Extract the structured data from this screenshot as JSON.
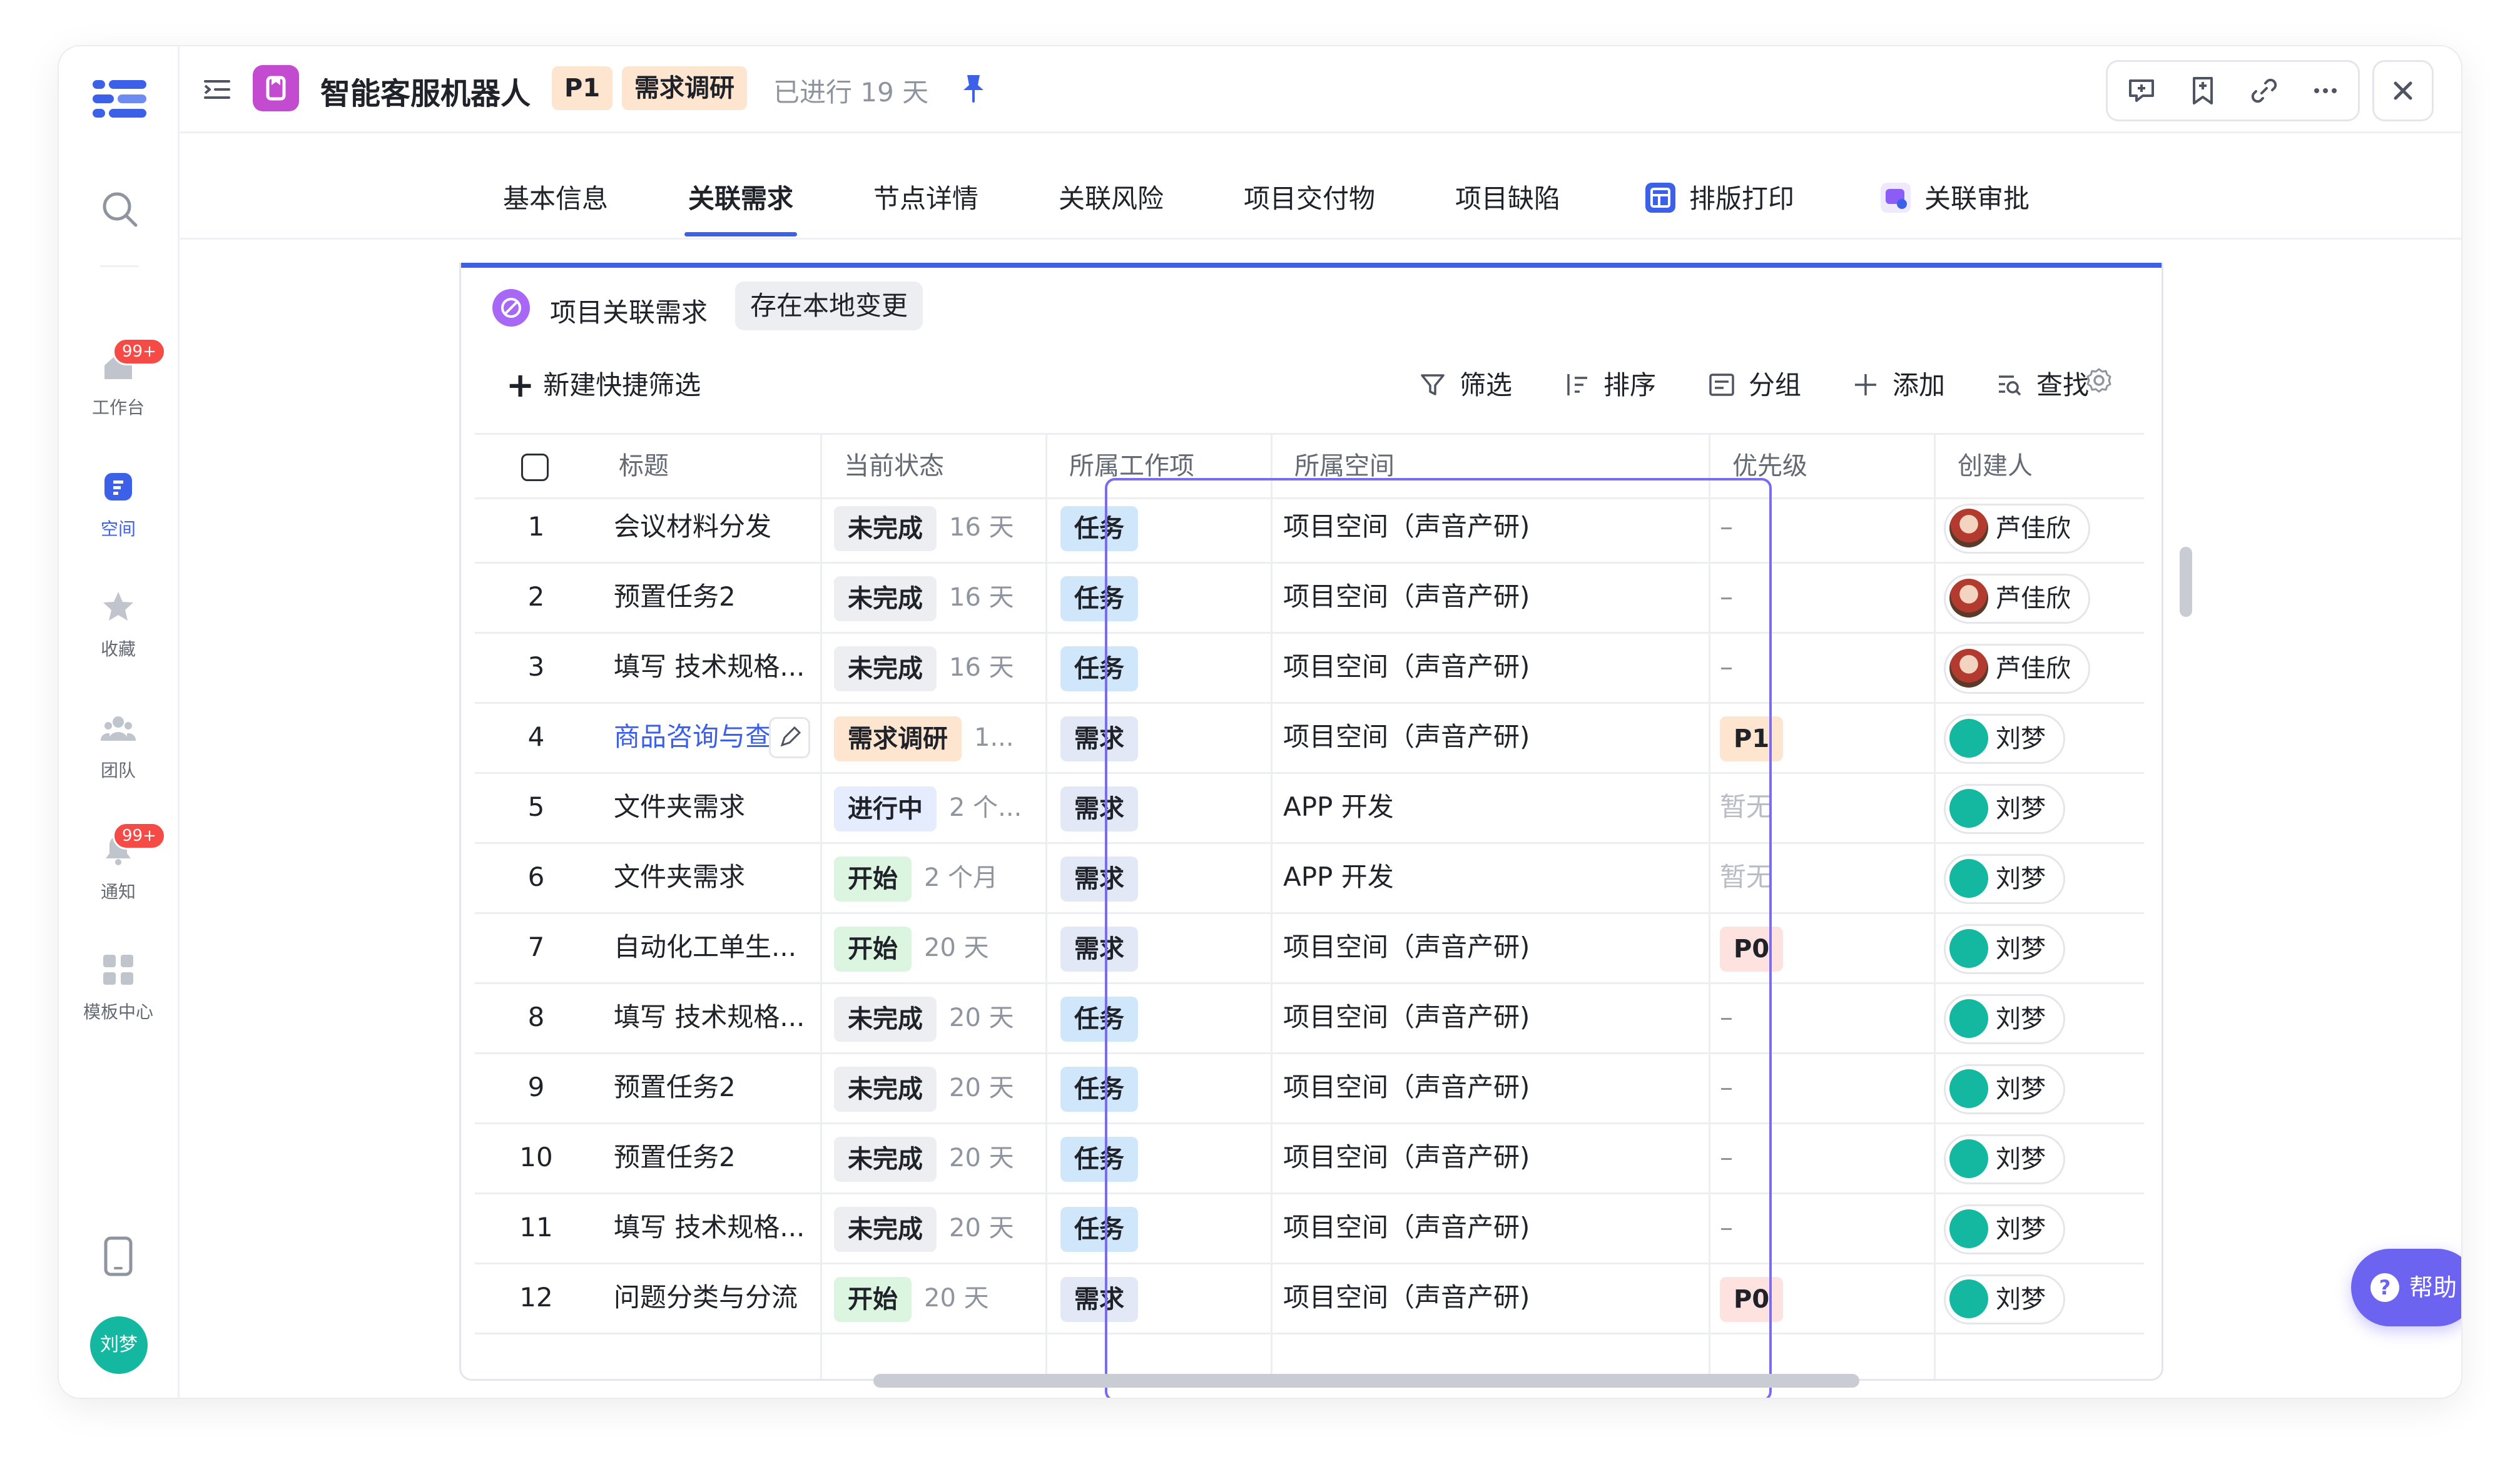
{
  "sidebar": {
    "items": [
      {
        "label": "工作台",
        "badge": "99+",
        "icon": "home-icon"
      },
      {
        "label": "空间",
        "badge": null,
        "icon": "space-icon",
        "active": true
      },
      {
        "label": "收藏",
        "badge": null,
        "icon": "star-icon"
      },
      {
        "label": "团队",
        "badge": null,
        "icon": "team-icon"
      },
      {
        "label": "通知",
        "badge": "99+",
        "icon": "bell-icon"
      },
      {
        "label": "模板中心",
        "badge": null,
        "icon": "template-icon"
      }
    ],
    "avatar_text": "刘梦"
  },
  "header": {
    "title": "智能客服机器人",
    "priority_tag": "P1",
    "stage_tag": "需求调研",
    "days_text": "已进行 19 天"
  },
  "tabs": [
    {
      "label": "基本信息"
    },
    {
      "label": "关联需求",
      "active": true
    },
    {
      "label": "节点详情"
    },
    {
      "label": "关联风险"
    },
    {
      "label": "项目交付物"
    },
    {
      "label": "项目缺陷"
    },
    {
      "label": "排版打印",
      "icon": "layout-print-icon"
    },
    {
      "label": "关联审批",
      "icon": "approval-icon"
    }
  ],
  "panel": {
    "title": "项目关联需求",
    "chip": "存在本地变更",
    "new_filter": "新建快捷筛选",
    "toolbar": {
      "filter": "筛选",
      "sort": "排序",
      "group": "分组",
      "add": "添加",
      "find": "查找"
    }
  },
  "table": {
    "headers": {
      "title": "标题",
      "status": "当前状态",
      "type": "所属工作项",
      "space": "所属空间",
      "priority": "优先级",
      "creator": "创建人"
    },
    "rows": [
      {
        "num": "1",
        "title": "会议材料分发",
        "status": "未完成",
        "status_color": "gray",
        "duration": "16 天",
        "type": "任务",
        "space": "项目空间（声音产研)",
        "priority": "–",
        "creator": "芦佳欣"
      },
      {
        "num": "2",
        "title": "预置任务2",
        "status": "未完成",
        "status_color": "gray",
        "duration": "16 天",
        "type": "任务",
        "space": "项目空间（声音产研)",
        "priority": "–",
        "creator": "芦佳欣"
      },
      {
        "num": "3",
        "title": "填写 技术规格...",
        "status": "未完成",
        "status_color": "gray",
        "duration": "16 天",
        "type": "任务",
        "space": "项目空间（声音产研)",
        "priority": "–",
        "creator": "芦佳欣"
      },
      {
        "num": "4",
        "title": "商品咨询与查",
        "status": "需求调研",
        "status_color": "orange",
        "duration": "1...",
        "type": "需求",
        "space": "项目空间（声音产研)",
        "priority": "P1",
        "creator": "刘梦"
      },
      {
        "num": "5",
        "title": "文件夹需求",
        "status": "进行中",
        "status_color": "blue",
        "duration": "2 个...",
        "type": "需求",
        "space": "APP 开发",
        "priority": "暂无",
        "creator": "刘梦"
      },
      {
        "num": "6",
        "title": "文件夹需求",
        "status": "开始",
        "status_color": "green",
        "duration": "2 个月",
        "type": "需求",
        "space": "APP 开发",
        "priority": "暂无",
        "creator": "刘梦"
      },
      {
        "num": "7",
        "title": "自动化工单生...",
        "status": "开始",
        "status_color": "green",
        "duration": "20 天",
        "type": "需求",
        "space": "项目空间（声音产研)",
        "priority": "P0",
        "creator": "刘梦"
      },
      {
        "num": "8",
        "title": "填写 技术规格...",
        "status": "未完成",
        "status_color": "gray",
        "duration": "20 天",
        "type": "任务",
        "space": "项目空间（声音产研)",
        "priority": "–",
        "creator": "刘梦"
      },
      {
        "num": "9",
        "title": "预置任务2",
        "status": "未完成",
        "status_color": "gray",
        "duration": "20 天",
        "type": "任务",
        "space": "项目空间（声音产研)",
        "priority": "–",
        "creator": "刘梦"
      },
      {
        "num": "10",
        "title": "预置任务2",
        "status": "未完成",
        "status_color": "gray",
        "duration": "20 天",
        "type": "任务",
        "space": "项目空间（声音产研)",
        "priority": "–",
        "creator": "刘梦"
      },
      {
        "num": "11",
        "title": "填写 技术规格...",
        "status": "未完成",
        "status_color": "gray",
        "duration": "20 天",
        "type": "任务",
        "space": "项目空间（声音产研)",
        "priority": "–",
        "creator": "刘梦"
      },
      {
        "num": "12",
        "title": "问题分类与分流",
        "status": "开始",
        "status_color": "green",
        "duration": "20 天",
        "type": "需求",
        "space": "项目空间（声音产研)",
        "priority": "P0",
        "creator": "刘梦"
      }
    ]
  },
  "help_button": "帮助",
  "colors": {
    "accent": "#3d60e8",
    "highlight_border": "#7a6cf0",
    "badge_red": "#f54a45",
    "avatar_teal": "#14b8a0"
  }
}
